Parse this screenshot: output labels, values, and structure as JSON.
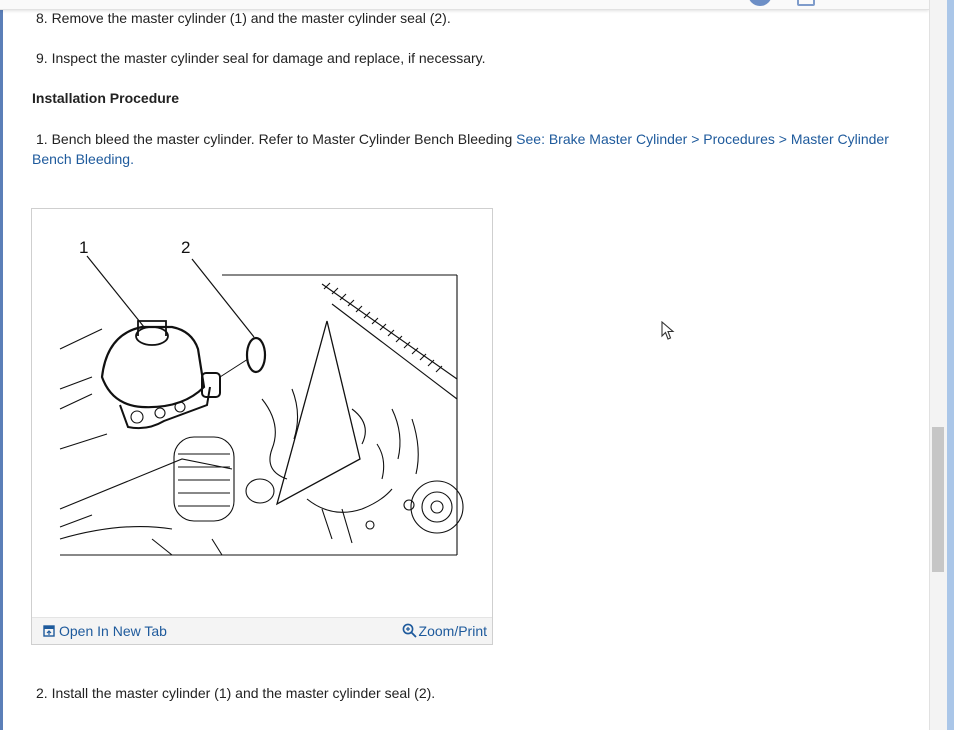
{
  "steps_removal": {
    "step8": "8. Remove the master cylinder (1) and the master cylinder seal (2).",
    "step9": "9. Inspect the master cylinder seal for damage and replace, if necessary."
  },
  "installation": {
    "heading": "Installation Procedure",
    "step1_text": "1. Bench bleed the master cylinder. Refer to Master Cylinder Bench Bleeding ",
    "step1_link_line1": "See: Brake Master Cylinder > Procedures > Master Cylinder",
    "step1_link_line2": "Bench Bleeding",
    "step1_end": ".",
    "step2": "2. Install the master cylinder (1) and the master cylinder seal (2)."
  },
  "figure": {
    "callout_1": "1",
    "callout_2": "2",
    "open_new_tab": "Open In New Tab",
    "zoom_print": "Zoom/Print"
  },
  "icons": {
    "open_tab": "open-new-tab-icon",
    "zoom": "zoom-icon",
    "cursor": "mouse-pointer-icon"
  },
  "colors": {
    "link": "#1e5a9c",
    "text": "#222222"
  }
}
